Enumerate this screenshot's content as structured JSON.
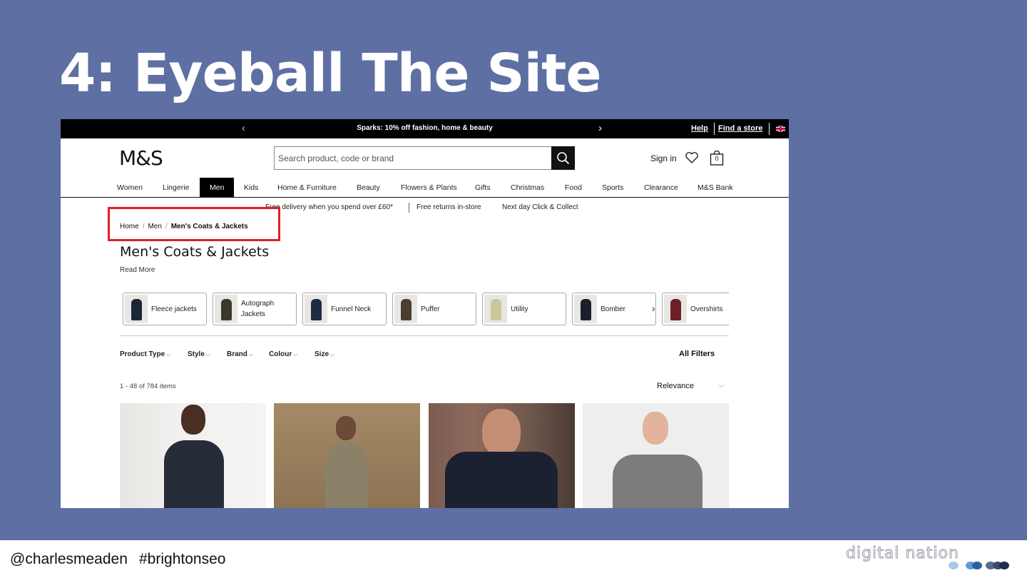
{
  "slide": {
    "title": "4: Eyeball The Site",
    "footer_handle": "@charlesmeaden",
    "footer_hashtag": "#brightonseo",
    "footer_logo": "digital nation",
    "background_color": "#5d6fa3"
  },
  "site": {
    "promo": {
      "message": "Sparks: 10% off fashion, home & beauty",
      "help": "Help",
      "find_store": "Find a store",
      "prev_icon": "chevron-left-icon",
      "next_icon": "chevron-right-icon"
    },
    "header": {
      "logo": "M&S",
      "search_placeholder": "Search product, code or brand",
      "sign_in": "Sign in",
      "bag_count": "0"
    },
    "nav": [
      "Women",
      "Lingerie",
      "Men",
      "Kids",
      "Home & Furniture",
      "Beauty",
      "Flowers & Plants",
      "Gifts",
      "Christmas",
      "Food",
      "Sports",
      "Clearance",
      "M&S Bank"
    ],
    "nav_active": "Men",
    "usps": [
      "Free delivery when you spend over £60*",
      "Free returns in-store",
      "Next day Click & Collect"
    ],
    "breadcrumb": [
      "Home",
      "Men",
      "Men's Coats & Jackets"
    ],
    "page_title": "Men's Coats & Jackets",
    "read_more": "Read More",
    "categories": [
      "Fleece jackets",
      "Autograph Jackets",
      "Funnel Neck",
      "Puffer",
      "Utility",
      "Bomber",
      "Overshirts"
    ],
    "filters": [
      "Product Type",
      "Style",
      "Brand",
      "Colour",
      "Size"
    ],
    "all_filters": "All Filters",
    "item_count": "1 - 48 of 784 items",
    "sort": "Relevance",
    "highlight_color": "#e02020"
  }
}
